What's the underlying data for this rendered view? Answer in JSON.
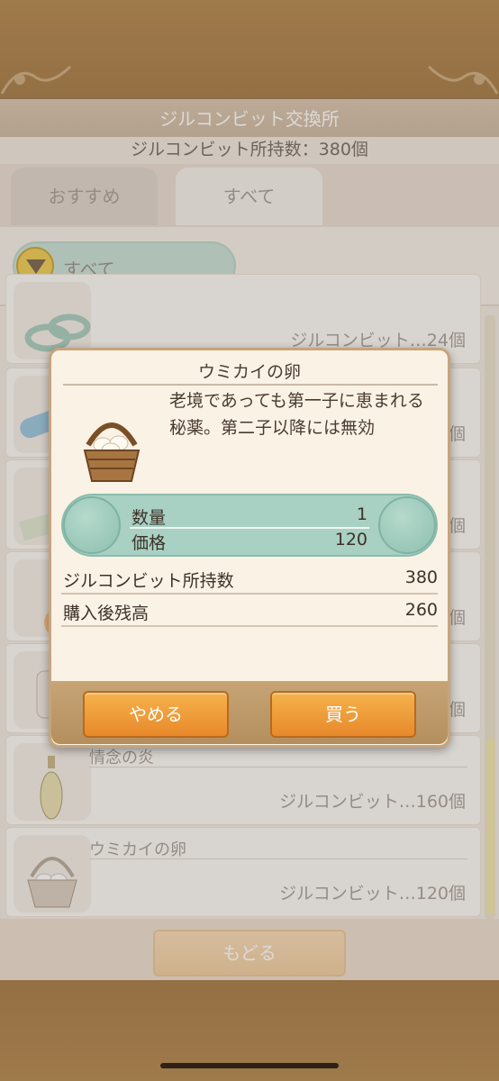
{
  "header": {
    "title": "ジルコンビット交換所",
    "balance_text": "ジルコンビット所持数：380個"
  },
  "tabs": [
    {
      "label": "おすすめ",
      "active": false
    },
    {
      "label": "すべて",
      "active": true
    }
  ],
  "filter": {
    "label": "すべて"
  },
  "list": {
    "items": [
      {
        "name": "",
        "price": "ジルコンビット…24個"
      },
      {
        "name": "",
        "price": "…個"
      },
      {
        "name": "",
        "price": "…個"
      },
      {
        "name": "",
        "price": "…個"
      },
      {
        "name": "",
        "price": "…個"
      },
      {
        "name": "情念の炎",
        "price": "ジルコンビット…160個"
      },
      {
        "name": "ウミカイの卵",
        "price": "ジルコンビット…120個"
      }
    ]
  },
  "dialog": {
    "item_name": "ウミカイの卵",
    "description": "老境であっても第一子に恵まれる秘薬。第二子以降には無効",
    "quantity_label": "数量",
    "quantity_value": "1",
    "price_label": "価格",
    "price_value": "120",
    "owned_label": "ジルコンビット所持数",
    "owned_value": "380",
    "after_label": "購入後残高",
    "after_value": "260",
    "cancel_label": "やめる",
    "buy_label": "買う"
  },
  "footer": {
    "back_label": "もどる"
  },
  "icons": {
    "filter": "chevron-down-icon",
    "basket": "egg-basket-icon"
  },
  "colors": {
    "accent_orange": "#e7892a",
    "teal": "#a8d0c3",
    "frame_brown": "#b08a58"
  }
}
